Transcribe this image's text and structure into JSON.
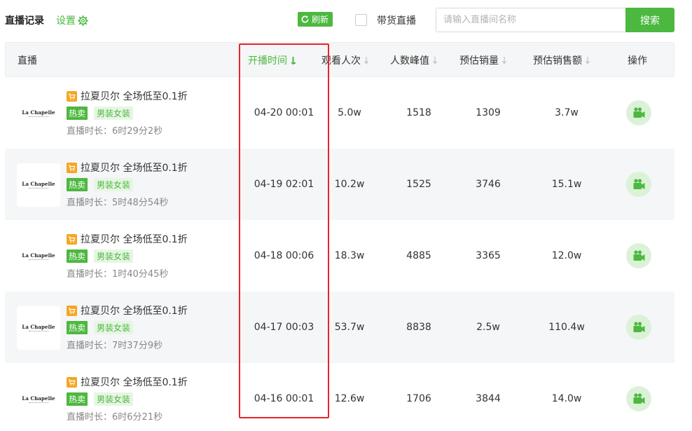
{
  "header": {
    "title": "直播记录",
    "settings_label": "设置",
    "refresh_label": "刷新",
    "checkbox_label": "带货直播",
    "search_placeholder": "请输入直播间名称",
    "search_button": "搜索"
  },
  "columns": {
    "live": "直播",
    "start_time": "开播时间",
    "views": "观看人次",
    "peak": "人数峰值",
    "sales_volume": "预估销量",
    "sales_amount": "预估销售额",
    "action": "操作"
  },
  "sort": {
    "active_column": "start_time",
    "active_color": "#4cb83f",
    "inactive_color": "#c8c8c8"
  },
  "colors": {
    "accent": "#4cb83f",
    "cart": "#f5a623",
    "highlight": "#e8242b"
  },
  "icons": {
    "settings": "gear-icon",
    "refresh": "refresh-icon",
    "cart": "cart-icon",
    "action": "video-camera-icon",
    "sort": "sort-down-arrow-icon"
  },
  "rows": [
    {
      "brand": "La Chapelle",
      "name": "拉夏贝尔 全场低至0.1折",
      "tag_hot": "热卖",
      "tag_cat": "男装女装",
      "duration": "直播时长：6时29分2秒",
      "start_time": "04-20 00:01",
      "views": "5.0w",
      "peak": "1518",
      "sales_volume": "1309",
      "sales_amount": "3.7w"
    },
    {
      "brand": "La Chapelle",
      "name": "拉夏贝尔 全场低至0.1折",
      "tag_hot": "热卖",
      "tag_cat": "男装女装",
      "duration": "直播时长：5时48分54秒",
      "start_time": "04-19 02:01",
      "views": "10.2w",
      "peak": "1525",
      "sales_volume": "3746",
      "sales_amount": "15.1w"
    },
    {
      "brand": "La Chapelle",
      "name": "拉夏贝尔 全场低至0.1折",
      "tag_hot": "热卖",
      "tag_cat": "男装女装",
      "duration": "直播时长：1时40分45秒",
      "start_time": "04-18 00:06",
      "views": "18.3w",
      "peak": "4885",
      "sales_volume": "3365",
      "sales_amount": "12.0w"
    },
    {
      "brand": "La Chapelle",
      "name": "拉夏贝尔 全场低至0.1折",
      "tag_hot": "热卖",
      "tag_cat": "男装女装",
      "duration": "直播时长：7时37分9秒",
      "start_time": "04-17 00:03",
      "views": "53.7w",
      "peak": "8838",
      "sales_volume": "2.5w",
      "sales_amount": "110.4w"
    },
    {
      "brand": "La Chapelle",
      "name": "拉夏贝尔 全场低至0.1折",
      "tag_hot": "热卖",
      "tag_cat": "男装女装",
      "duration": "直播时长：6时6分21秒",
      "start_time": "04-16 00:01",
      "views": "12.6w",
      "peak": "1706",
      "sales_volume": "3844",
      "sales_amount": "14.0w"
    }
  ]
}
